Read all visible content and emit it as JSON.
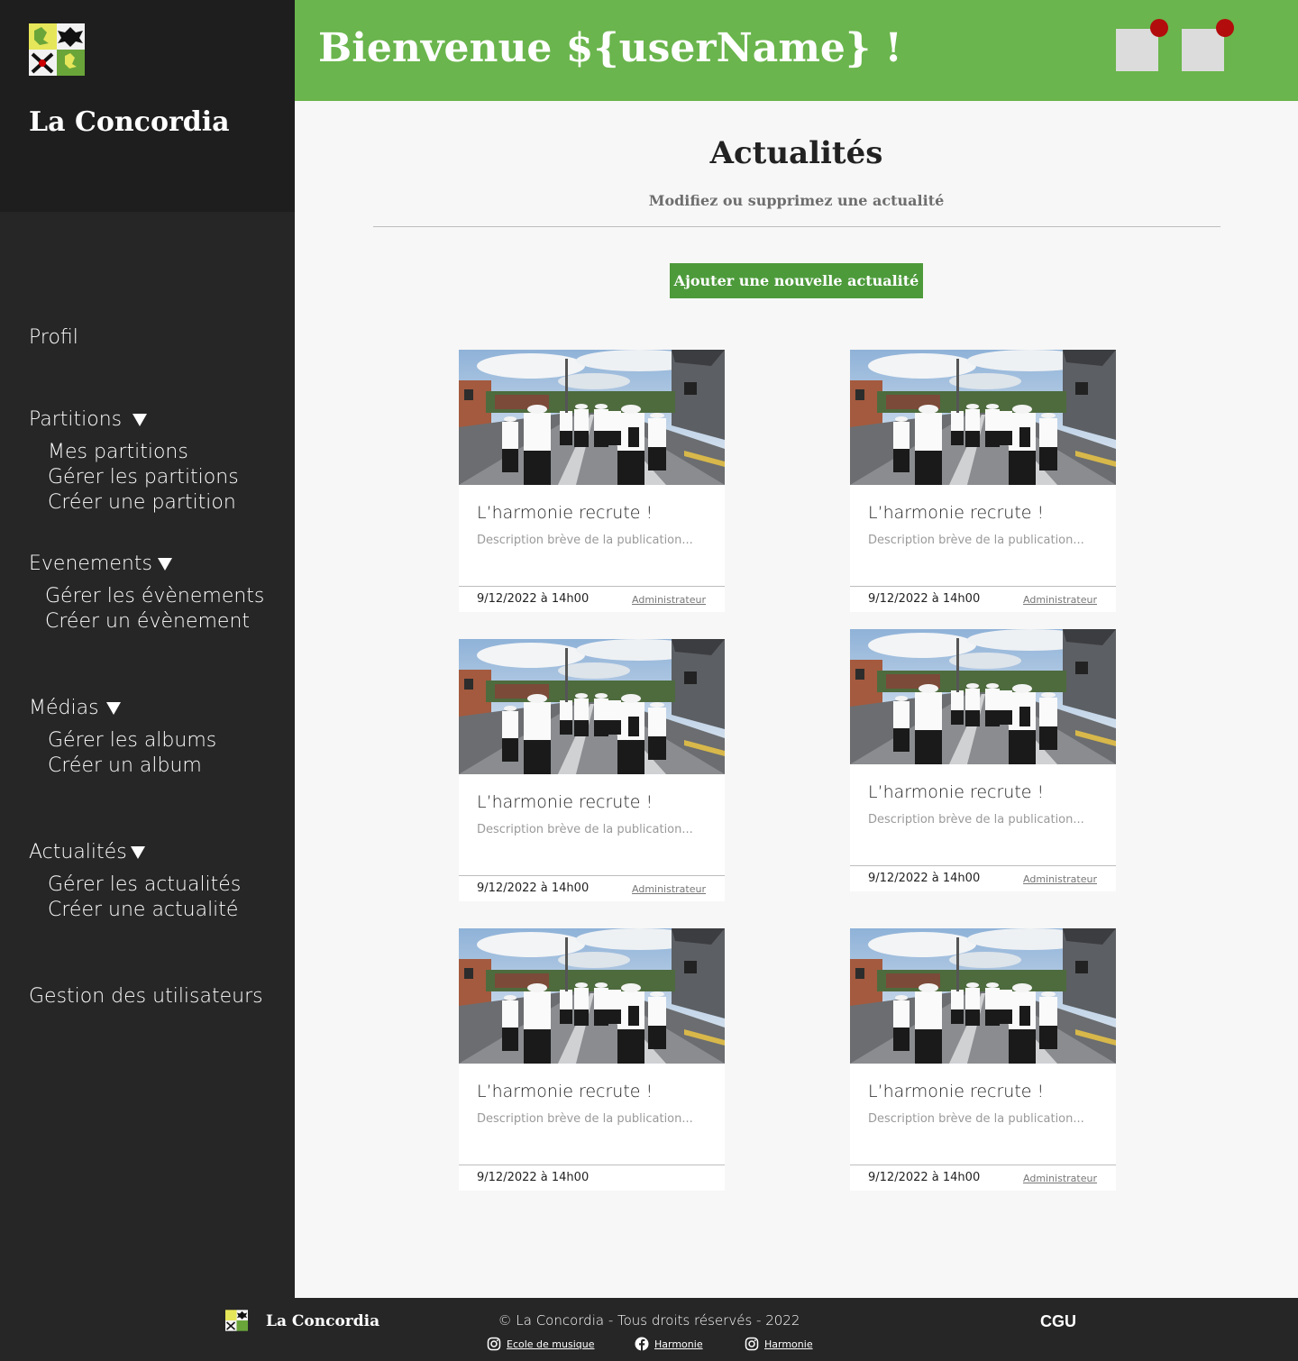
{
  "sidebar": {
    "brand": "La Concordia",
    "items": [
      {
        "label": "Profil"
      },
      {
        "label": "Partitions",
        "subs": [
          "Mes partitions",
          "Gérer les partitions",
          "Créer une partition"
        ]
      },
      {
        "label": "Evenements",
        "subs": [
          "Gérer les évènements",
          "Créer un évènement"
        ]
      },
      {
        "label": "Médias",
        "subs": [
          "Gérer les albums",
          "Créer un album"
        ]
      },
      {
        "label": "Actualités",
        "subs": [
          "Gérer les actualités",
          "Créer une actualité"
        ]
      },
      {
        "label": "Gestion des utilisateurs"
      }
    ]
  },
  "header": {
    "welcome": "Bienvenue ${userName} !"
  },
  "main": {
    "title": "Actualités",
    "subtitle": "Modifiez ou supprimez une actualité",
    "add_button": "Ajouter une nouvelle actualité",
    "cards": [
      {
        "title": "L’harmonie recrute !",
        "desc": "Description brève de la publication...",
        "date": "9/12/2022 à 14h00",
        "author": "Administrateur"
      },
      {
        "title": "L’harmonie recrute !",
        "desc": "Description brève de la publication...",
        "date": "9/12/2022 à 14h00",
        "author": "Administrateur"
      },
      {
        "title": "L’harmonie recrute !",
        "desc": "Description brève de la publication...",
        "date": "9/12/2022 à 14h00",
        "author": "Administrateur"
      },
      {
        "title": "L’harmonie recrute !",
        "desc": "Description brève de la publication...",
        "date": "9/12/2022 à 14h00",
        "author": "Administrateur"
      },
      {
        "title": "L’harmonie recrute !",
        "desc": "Description brève de la publication...",
        "date": "9/12/2022 à 14h00",
        "author": ""
      },
      {
        "title": "L’harmonie recrute !",
        "desc": "Description brève de la publication...",
        "date": "9/12/2022 à 14h00",
        "author": "Administrateur"
      }
    ]
  },
  "footer": {
    "brand": "La Concordia",
    "copyright": "© La Concordia - Tous droits réservés - 2022",
    "cgu": "CGU",
    "links": [
      {
        "label": "Ecole de musique",
        "icon": "instagram-icon"
      },
      {
        "label": "Harmonie",
        "icon": "facebook-icon"
      },
      {
        "label": "Harmonie",
        "icon": "instagram-icon"
      }
    ]
  },
  "colors": {
    "header_green": "#6ab54d",
    "button_green": "#4d9a3b",
    "sidebar_bg": "#262626",
    "notification_dot": "#b30c0c"
  }
}
